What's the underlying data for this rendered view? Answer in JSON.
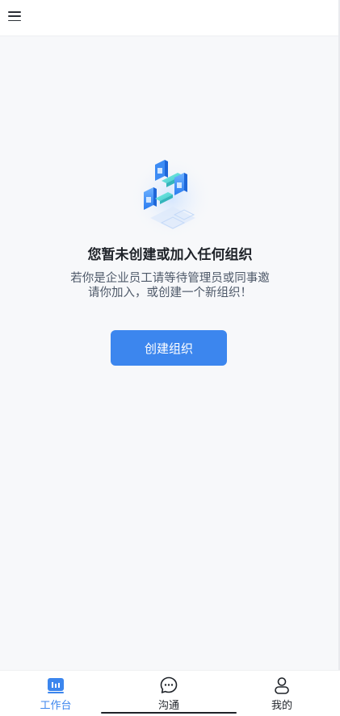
{
  "header": {
    "menu_icon": "hamburger-menu-icon"
  },
  "empty_state": {
    "illustration": "blocks-illustration",
    "title": "您暂未创建或加入任何组织",
    "description": "若你是企业员工请等待管理员或同事邀请你加入，或创建一个新组织！"
  },
  "primary_action": {
    "label": "创建组织",
    "color": "#3c86ee"
  },
  "tabbar": {
    "active_color": "#3c86ee",
    "tabs": [
      {
        "label": "工作台",
        "icon": "workbench-icon",
        "active": true
      },
      {
        "label": "沟通",
        "icon": "chat-bubble-icon",
        "active": false
      },
      {
        "label": "我的",
        "icon": "profile-icon",
        "active": false
      }
    ]
  }
}
